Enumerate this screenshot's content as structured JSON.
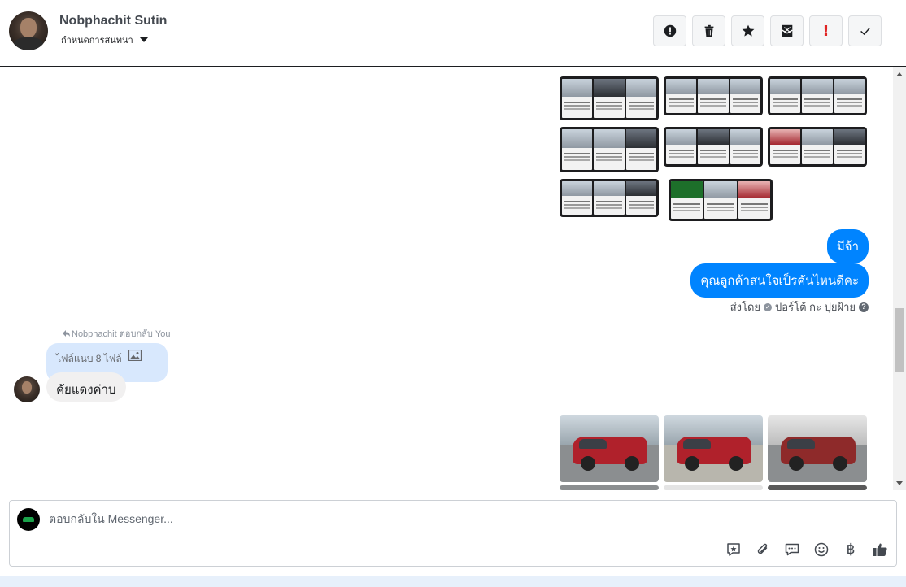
{
  "header": {
    "contact_name": "Nobphachit Sutin",
    "assign_label": "กำหนดการสนทนา",
    "actions": [
      "alert-icon",
      "trash-icon",
      "star-icon",
      "mark-unread-icon",
      "exclamation-icon",
      "check-icon"
    ],
    "exclamation_glyph": "!"
  },
  "thread": {
    "outgoing": [
      {
        "text": "มีจ้า"
      },
      {
        "text": "คุณลูกค้าสนใจเป็รคันไหนดีคะ"
      }
    ],
    "sent_by_label": "ส่งโดย",
    "sent_by_name": "ปอร์โต้ กะ ปุยฝ้าย",
    "reply_note": "Nobphachit ตอบกลับ You",
    "reply_quote": "ไฟล์แนบ 8 ไฟล์",
    "incoming": {
      "text": "คัยแดงค่าบ"
    }
  },
  "composer": {
    "placeholder": "ตอบกลับใน Messenger...",
    "currency_glyph": "฿",
    "tools": [
      "saved-reply-icon",
      "attach-icon",
      "chat-icon",
      "emoji-icon",
      "baht-icon",
      "like-icon"
    ]
  },
  "colors": {
    "outgoing_bubble": "#0084ff",
    "incoming_bubble": "#f1f0f0",
    "quote_bubble": "#d8e8fd",
    "danger": "#e02424"
  }
}
